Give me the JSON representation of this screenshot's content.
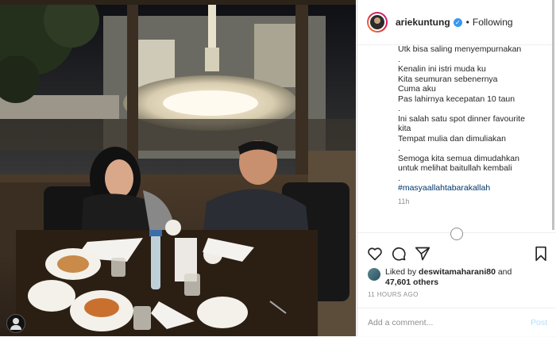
{
  "header": {
    "username": "ariekuntung",
    "dot": "•",
    "follow_status": "Following"
  },
  "caption": {
    "lines": [
      "Utk bisa saling menyempurnakan",
      ".",
      "Kenalin ini istri muda ku",
      "Kita seumuran sebenernya",
      "Cuma aku",
      "Pas lahirnya kecepatan 10 taun",
      ".",
      "Ini salah satu spot dinner favourite",
      "kita",
      "Tempat mulia dan dimuliakan",
      ".",
      "Semoga kita semua dimudahkan",
      "untuk melihat baitullah kembali",
      "."
    ],
    "hashtag": "#masyaallahtabarakallah",
    "time": "11h"
  },
  "likes": {
    "prefix": "Liked by",
    "user": "deswitamaharani80",
    "and": "and",
    "count": "47,601 others"
  },
  "timestamp": "11 HOURS AGO",
  "comment": {
    "placeholder": "Add a comment...",
    "post_label": "Post"
  },
  "icons": [
    "heart-icon",
    "comment-icon",
    "share-icon",
    "bookmark-icon",
    "verified-icon",
    "user-tag-icon"
  ],
  "colors": {
    "verified": "#3897f0",
    "post_disabled": "#b2dffc",
    "hashtag": "#003569"
  }
}
